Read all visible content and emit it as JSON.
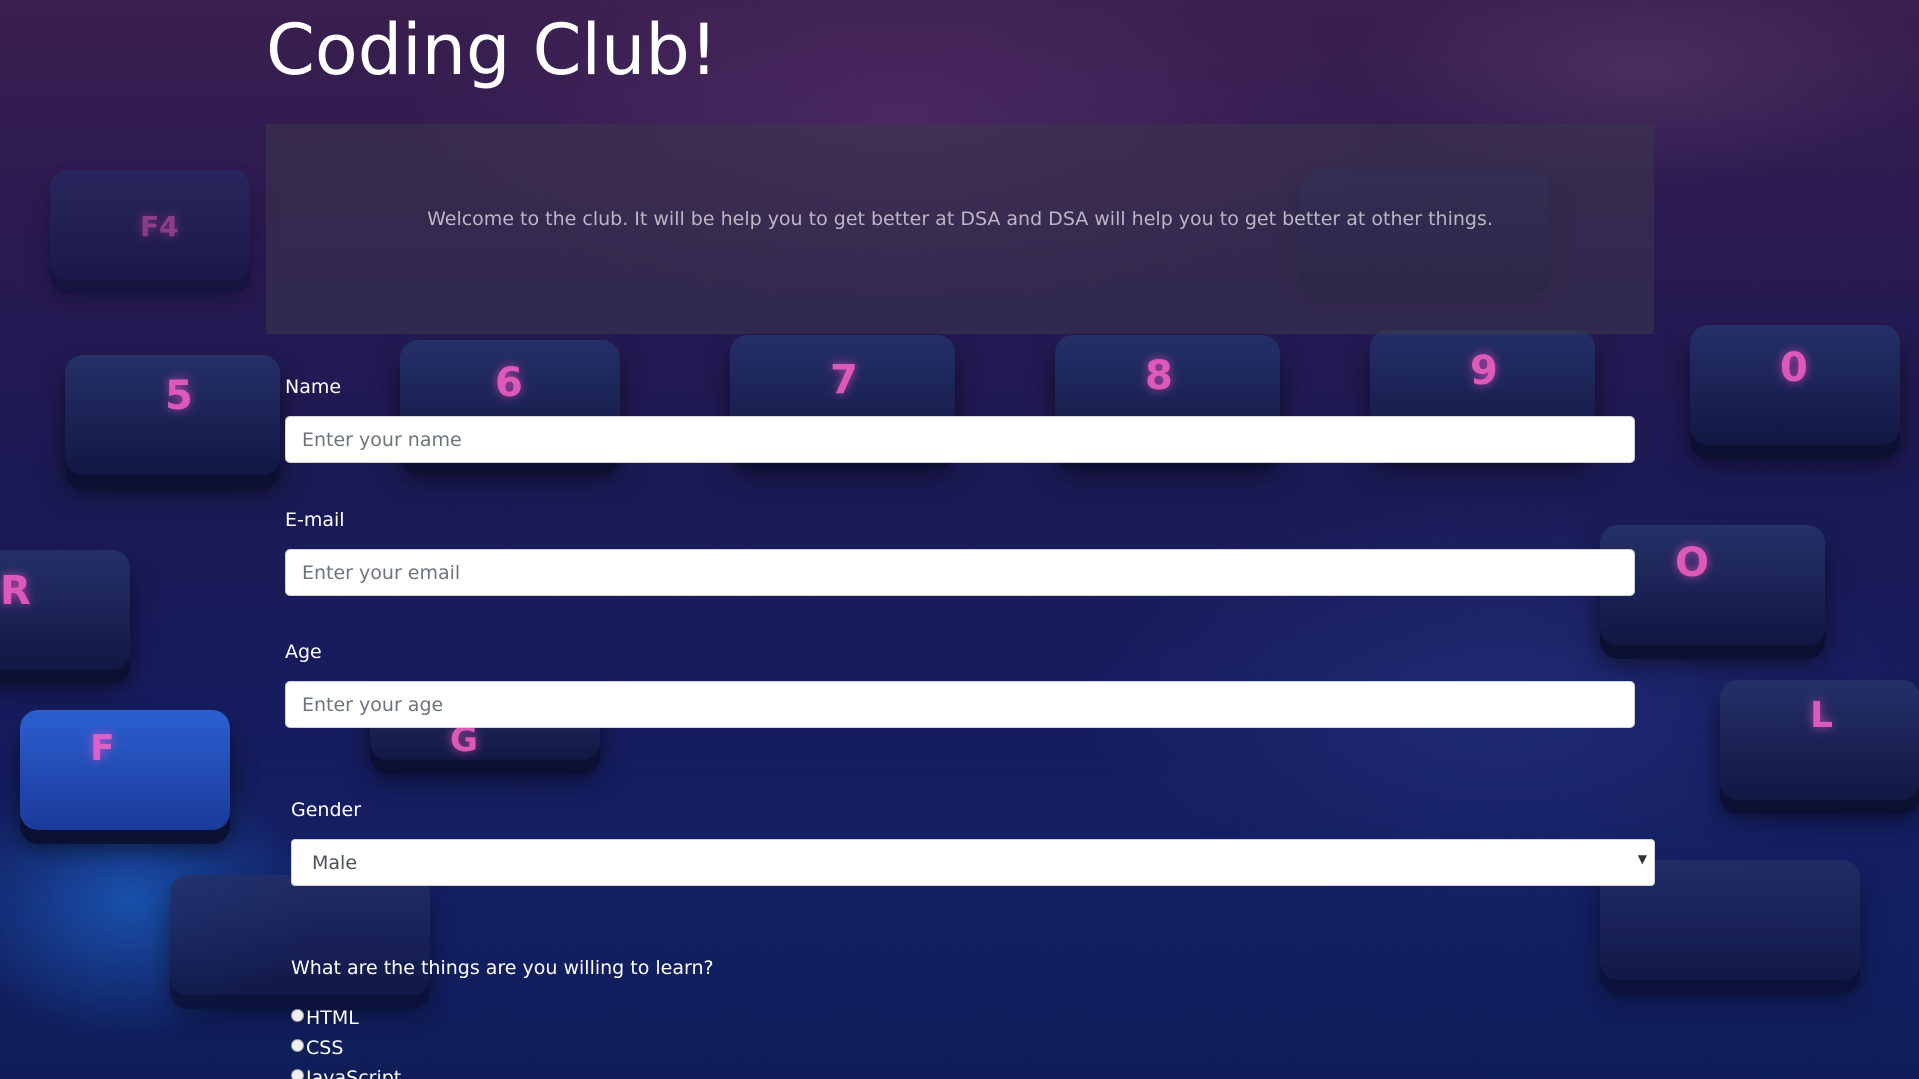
{
  "header": {
    "title": "Coding Club!"
  },
  "jumbotron": {
    "text": "Welcome to the club. It will be help you to get better at DSA and DSA will help you to get better at other things."
  },
  "form": {
    "name": {
      "label": "Name",
      "placeholder": "Enter your name"
    },
    "email": {
      "label": "E-mail",
      "placeholder": "Enter your email"
    },
    "age": {
      "label": "Age",
      "placeholder": "Enter your age"
    },
    "gender": {
      "label": "Gender",
      "selected": "Male"
    },
    "learn": {
      "question": "What are the things are you willing to learn?",
      "options": [
        "HTML",
        "CSS",
        "JavaScript"
      ]
    }
  },
  "background": {
    "key_labels": [
      "F4",
      "5",
      "6",
      "7",
      "8",
      "9",
      "0",
      "R",
      "O",
      "F",
      "G",
      "L"
    ]
  }
}
